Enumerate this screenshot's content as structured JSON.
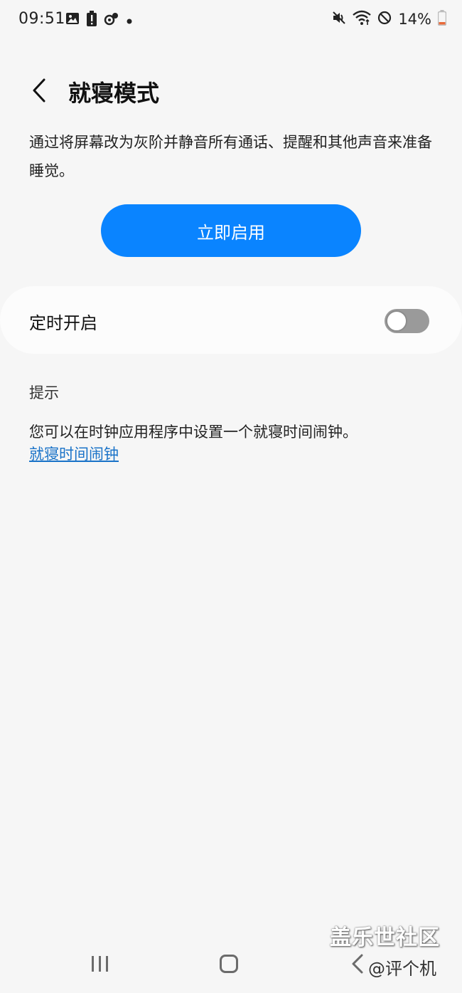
{
  "status_bar": {
    "time": "09:51",
    "battery_percent": "14%",
    "left_icons": [
      "gallery-icon",
      "battery-alert-icon",
      "app-notification-icon",
      "dot-icon"
    ],
    "right_icons": [
      "mute-icon",
      "wifi-icon",
      "do-not-disturb-icon",
      "battery-icon"
    ]
  },
  "header": {
    "title": "就寝模式"
  },
  "description": "通过将屏幕改为灰阶并静音所有通话、提醒和其他声音来准备睡觉。",
  "primary_button": {
    "label": "立即启用",
    "color": "#0a84ff"
  },
  "schedule": {
    "label": "定时开启",
    "enabled": false
  },
  "tips": {
    "heading": "提示",
    "text": "您可以在时钟应用程序中设置一个就寝时间闹钟。",
    "link": "就寝时间闹钟",
    "link_color": "#1a73c8"
  },
  "watermark": {
    "line1": "盖乐世社区",
    "line2": "@评个机"
  }
}
